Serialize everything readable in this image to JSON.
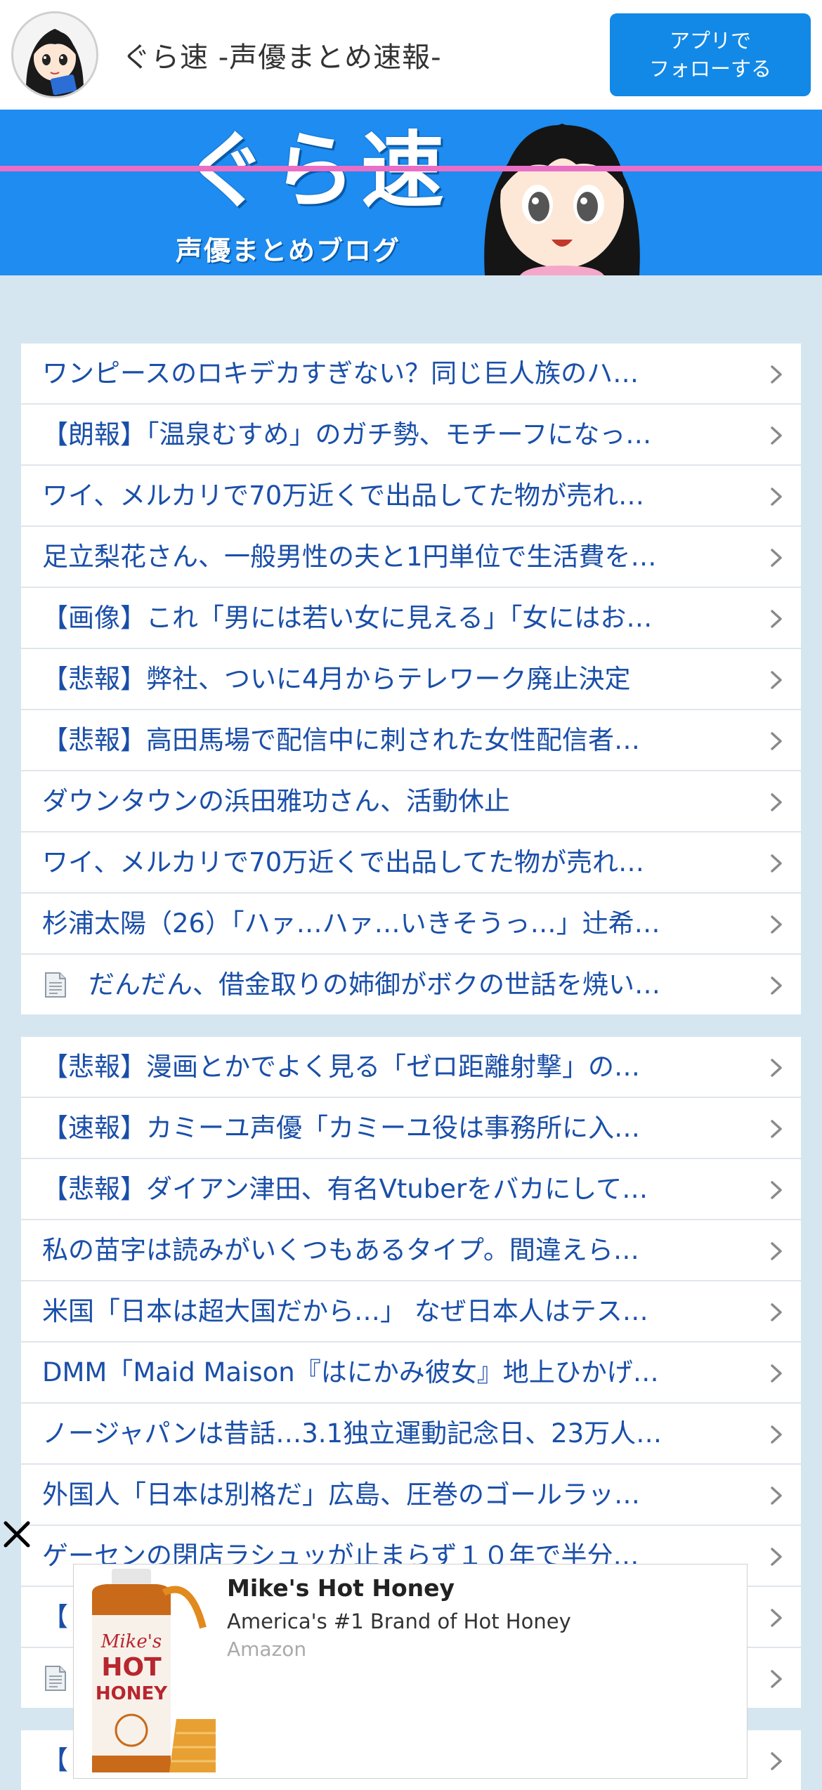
{
  "header": {
    "site_name": "ぐら速 -声優まとめ速報-",
    "follow_line1": "アプリで",
    "follow_line2": "フォローする"
  },
  "banner": {
    "logo_text": "ぐら速",
    "sub_text": "声優まとめブログ"
  },
  "list1": [
    {
      "text": "ワンピースのロキデカすぎない？同じ巨人族のハ…",
      "doc_icon": false
    },
    {
      "text": "【朗報】「温泉むすめ」のガチ勢、モチーフになっ…",
      "doc_icon": false
    },
    {
      "text": "ワイ、メルカリで70万近くで出品してた物が売れ…",
      "doc_icon": false
    },
    {
      "text": "足立梨花さん、一般男性の夫と1円単位で生活費を…",
      "doc_icon": false
    },
    {
      "text": "【画像】これ「男には若い女に見える」「女にはお…",
      "doc_icon": false
    },
    {
      "text": "【悲報】弊社、ついに4月からテレワーク廃止決定",
      "doc_icon": false
    },
    {
      "text": "【悲報】高田馬場で配信中に刺された女性配信者…",
      "doc_icon": false
    },
    {
      "text": "ダウンタウンの浜田雅功さん、活動休止",
      "doc_icon": false
    },
    {
      "text": "ワイ、メルカリで70万近くで出品してた物が売れ…",
      "doc_icon": false
    },
    {
      "text": "杉浦太陽（26）「ハァ…ハァ…いきそうっ…」辻希…",
      "doc_icon": false
    },
    {
      "text": "だんだん、借金取りの姉御がボクの世話を焼い…",
      "doc_icon": true
    }
  ],
  "list2": [
    {
      "text": "【悲報】漫画とかでよく見る「ゼロ距離射撃」の…",
      "doc_icon": false
    },
    {
      "text": "【速報】カミーユ声優「カミーユ役は事務所に入…",
      "doc_icon": false
    },
    {
      "text": "【悲報】ダイアン津田、有名Vtuberをバカにして…",
      "doc_icon": false
    },
    {
      "text": "私の苗字は読みがいくつもあるタイプ。間違えら…",
      "doc_icon": false
    },
    {
      "text": "米国「日本は超大国だから…」 なぜ日本人はテス…",
      "doc_icon": false
    },
    {
      "text": "DMM「Maid Maison『はにかみ彼女』地上ひかげ…",
      "doc_icon": false
    },
    {
      "text": "ノージャパンは昔話…3.1独立運動記念日、23万人…",
      "doc_icon": false
    },
    {
      "text": "外国人「日本は別格だ」広島、圧巻のゴールラッ…",
      "doc_icon": false
    },
    {
      "text": "ゲーセンの閉店ラシュッが止まらず１０年で半分…",
      "doc_icon": false
    },
    {
      "text": "【",
      "doc_icon": false
    },
    {
      "text": "",
      "doc_icon": true
    }
  ],
  "list3": [
    {
      "text": "【",
      "doc_icon": false
    }
  ],
  "ad": {
    "title": "Mike's Hot Honey",
    "description": "America's #1 Brand of Hot Honey",
    "source": "Amazon",
    "label_mikes": "Mike's",
    "label_hot": "HOT",
    "label_honey": "HONEY"
  },
  "colors": {
    "link": "#1a4fa8",
    "accent": "#1289e6",
    "banner": "#1e8cf0",
    "stripe": "#e96fc6",
    "background": "#d6e6f0"
  }
}
